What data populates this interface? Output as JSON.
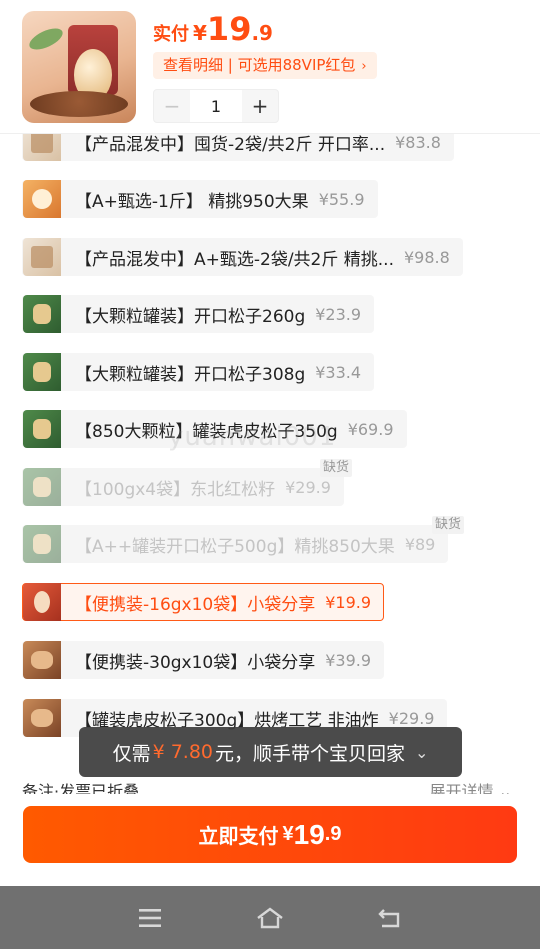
{
  "header": {
    "pay_label": "实付",
    "currency": "¥",
    "price_int": "19",
    "price_dec": ".9",
    "detail_text": "查看明细 | 可选用88VIP红包",
    "detail_chevron": "›",
    "quantity": "1",
    "minus": "−",
    "plus": "+"
  },
  "options": [
    {
      "name": "【产品混发中】囤货-2袋/共2斤 开口率...",
      "price": "¥83.8",
      "state": "normal",
      "thumb": "beige"
    },
    {
      "name": "【A+甄选-1斤】 精挑950大果",
      "price": "¥55.9",
      "state": "normal",
      "thumb": "orange"
    },
    {
      "name": "【产品混发中】A+甄选-2袋/共2斤 精挑...",
      "price": "¥98.8",
      "state": "normal",
      "thumb": "beige"
    },
    {
      "name": "【大颗粒罐装】开口松子260g",
      "price": "¥23.9",
      "state": "normal",
      "thumb": "green"
    },
    {
      "name": "【大颗粒罐装】开口松子308g",
      "price": "¥33.4",
      "state": "normal",
      "thumb": "green"
    },
    {
      "name": "【850大颗粒】罐装虎皮松子350g",
      "price": "¥69.9",
      "state": "normal",
      "thumb": "green"
    },
    {
      "name": "【100gx4袋】东北红松籽",
      "price": "¥29.9",
      "state": "out",
      "badge": "缺货",
      "thumb": "green"
    },
    {
      "name": "【A++罐装开口松子500g】精挑850大果",
      "price": "¥89",
      "state": "out",
      "badge": "缺货",
      "thumb": "green"
    },
    {
      "name": "【便携装-16gx10袋】小袋分享",
      "price": "¥19.9",
      "state": "selected",
      "thumb": "red"
    },
    {
      "name": "【便携装-30gx10袋】小袋分享",
      "price": "¥39.9",
      "state": "normal",
      "thumb": "brown"
    },
    {
      "name": "【罐装虎皮松子300g】烘烤工艺 非油炸",
      "price": "¥29.9",
      "state": "normal",
      "thumb": "brown"
    }
  ],
  "watermark": "yuanwai001",
  "toast": {
    "prefix": "仅需",
    "amount": "¥ 7.80",
    "suffix": "元，顺手带个宝贝回家",
    "chevron": "⌄"
  },
  "remark": {
    "text": "备注·发票已折叠",
    "expand": "展开详情 ⌄"
  },
  "pay_button": {
    "label": "立即支付",
    "currency": "¥",
    "price_int": "19",
    "price_dec": ".9"
  },
  "navbar": {
    "menu_icon": "menu-icon",
    "home_icon": "home-icon",
    "back_icon": "back-icon"
  },
  "colors": {
    "accent": "#ff4d12",
    "selected_border": "#ff5a17",
    "toast_bg": "#3c3c3c",
    "navbar_bg": "#707070"
  }
}
